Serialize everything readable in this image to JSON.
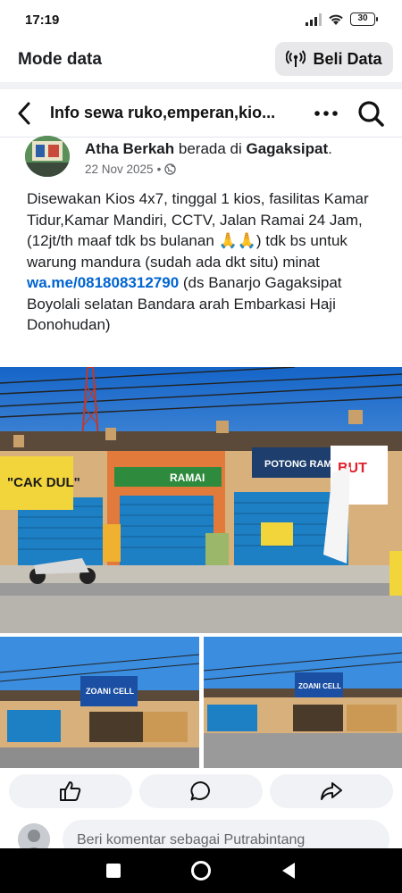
{
  "status": {
    "time": "17:19",
    "battery": "30"
  },
  "mode_bar": {
    "title": "Mode data",
    "buy_label": "Beli Data"
  },
  "header": {
    "title": "Info sewa ruko,emperan,kio..."
  },
  "post": {
    "author": "Atha Berkah",
    "at_text": "berada di",
    "location": "Gagaksipat",
    "after_location": ".",
    "date": "22 Nov 2025",
    "date_sep": "•",
    "text_before_link": "Disewakan Kios 4x7, tinggal 1 kios, fasilitas Kamar Tidur,Kamar Mandiri, CCTV, Jalan Ramai 24 Jam,(12jt/th maaf tdk bs bulanan 🙏🙏) tdk bs untuk warung mandura (sudah ada dkt situ) minat ",
    "link": "wa.me/081808312790",
    "text_after_link": " (ds Banarjo Gagaksipat Boyolali selatan Bandara arah Embarkasi Haji Donohudan)"
  },
  "photos": {
    "sign_left": "\"CAK DUL\"",
    "sign_middle": "RAMAI",
    "sign_right": "POTONG RAMBUT",
    "sign_right_short": "BUT",
    "sign_small_left": "ZOANI CELL",
    "sign_small_right": "ZOANI CELL"
  },
  "comment": {
    "placeholder": "Beri komentar sebagai Putrabintang"
  },
  "colors": {
    "link": "#0064d1",
    "sky": "#1f7fd8",
    "shutter": "#1d7fc4"
  }
}
